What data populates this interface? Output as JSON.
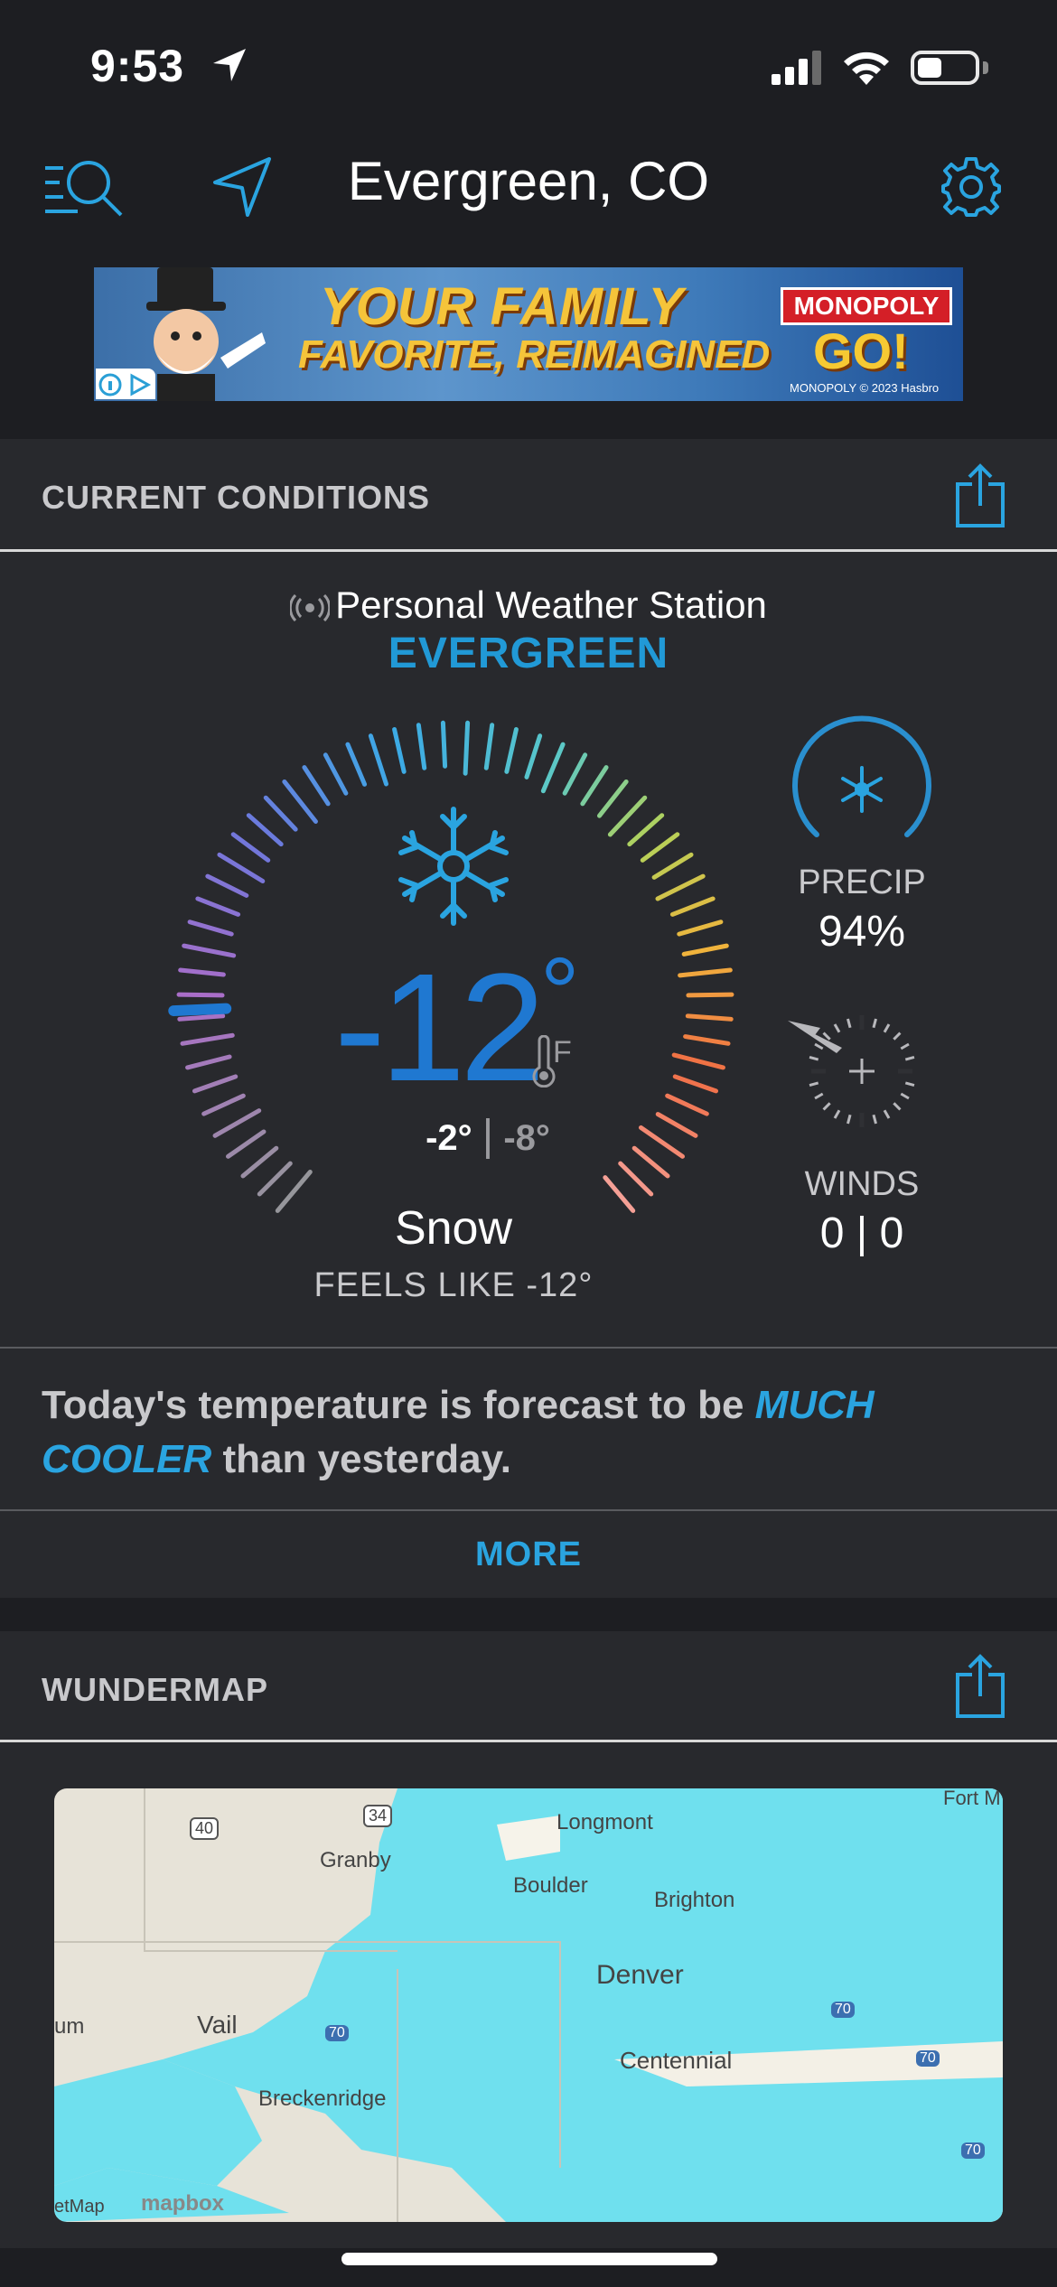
{
  "status_bar": {
    "time": "9:53"
  },
  "nav": {
    "title": "Evergreen, CO",
    "icons": [
      "search-list-icon",
      "location-arrow-icon",
      "gear-icon"
    ]
  },
  "ad": {
    "headline_1": "YOUR FAMILY",
    "headline_2": "FAVORITE, REIMAGINED",
    "brand": "MONOPOLY",
    "brand_sub": "GO!",
    "copyright": "MONOPOLY © 2023 Hasbro"
  },
  "current_conditions": {
    "section_title": "CURRENT CONDITIONS",
    "station_type": "Personal Weather Station",
    "station_name": "EVERGREEN",
    "temperature": "-12",
    "degree": "°",
    "unit": "F",
    "high": "-2°",
    "separator": "|",
    "low": "-8°",
    "condition": "Snow",
    "feels_like": "FEELS LIKE -12°",
    "precip_label": "PRECIP",
    "precip_value": "94%",
    "winds_label": "WINDS",
    "winds_value": "0 | 0"
  },
  "summary": {
    "text_before": "Today's temperature is forecast to be ",
    "highlight": "MUCH COOLER",
    "text_after": " than yesterday."
  },
  "more_label": "MORE",
  "wundermap": {
    "section_title": "WUNDERMAP",
    "labels": [
      "Granby",
      "Longmont",
      "Boulder",
      "Brighton",
      "Denver",
      "Vail",
      "Centennial",
      "Breckenridge",
      "Fort M",
      "um",
      "etMap",
      "mapbox"
    ],
    "highways": [
      "40",
      "34",
      "70",
      "70",
      "70",
      "70"
    ]
  },
  "colors": {
    "accent": "#2aa4e0",
    "temp": "#1f78d1",
    "background": "#1d1e22",
    "panel": "#28292d"
  }
}
